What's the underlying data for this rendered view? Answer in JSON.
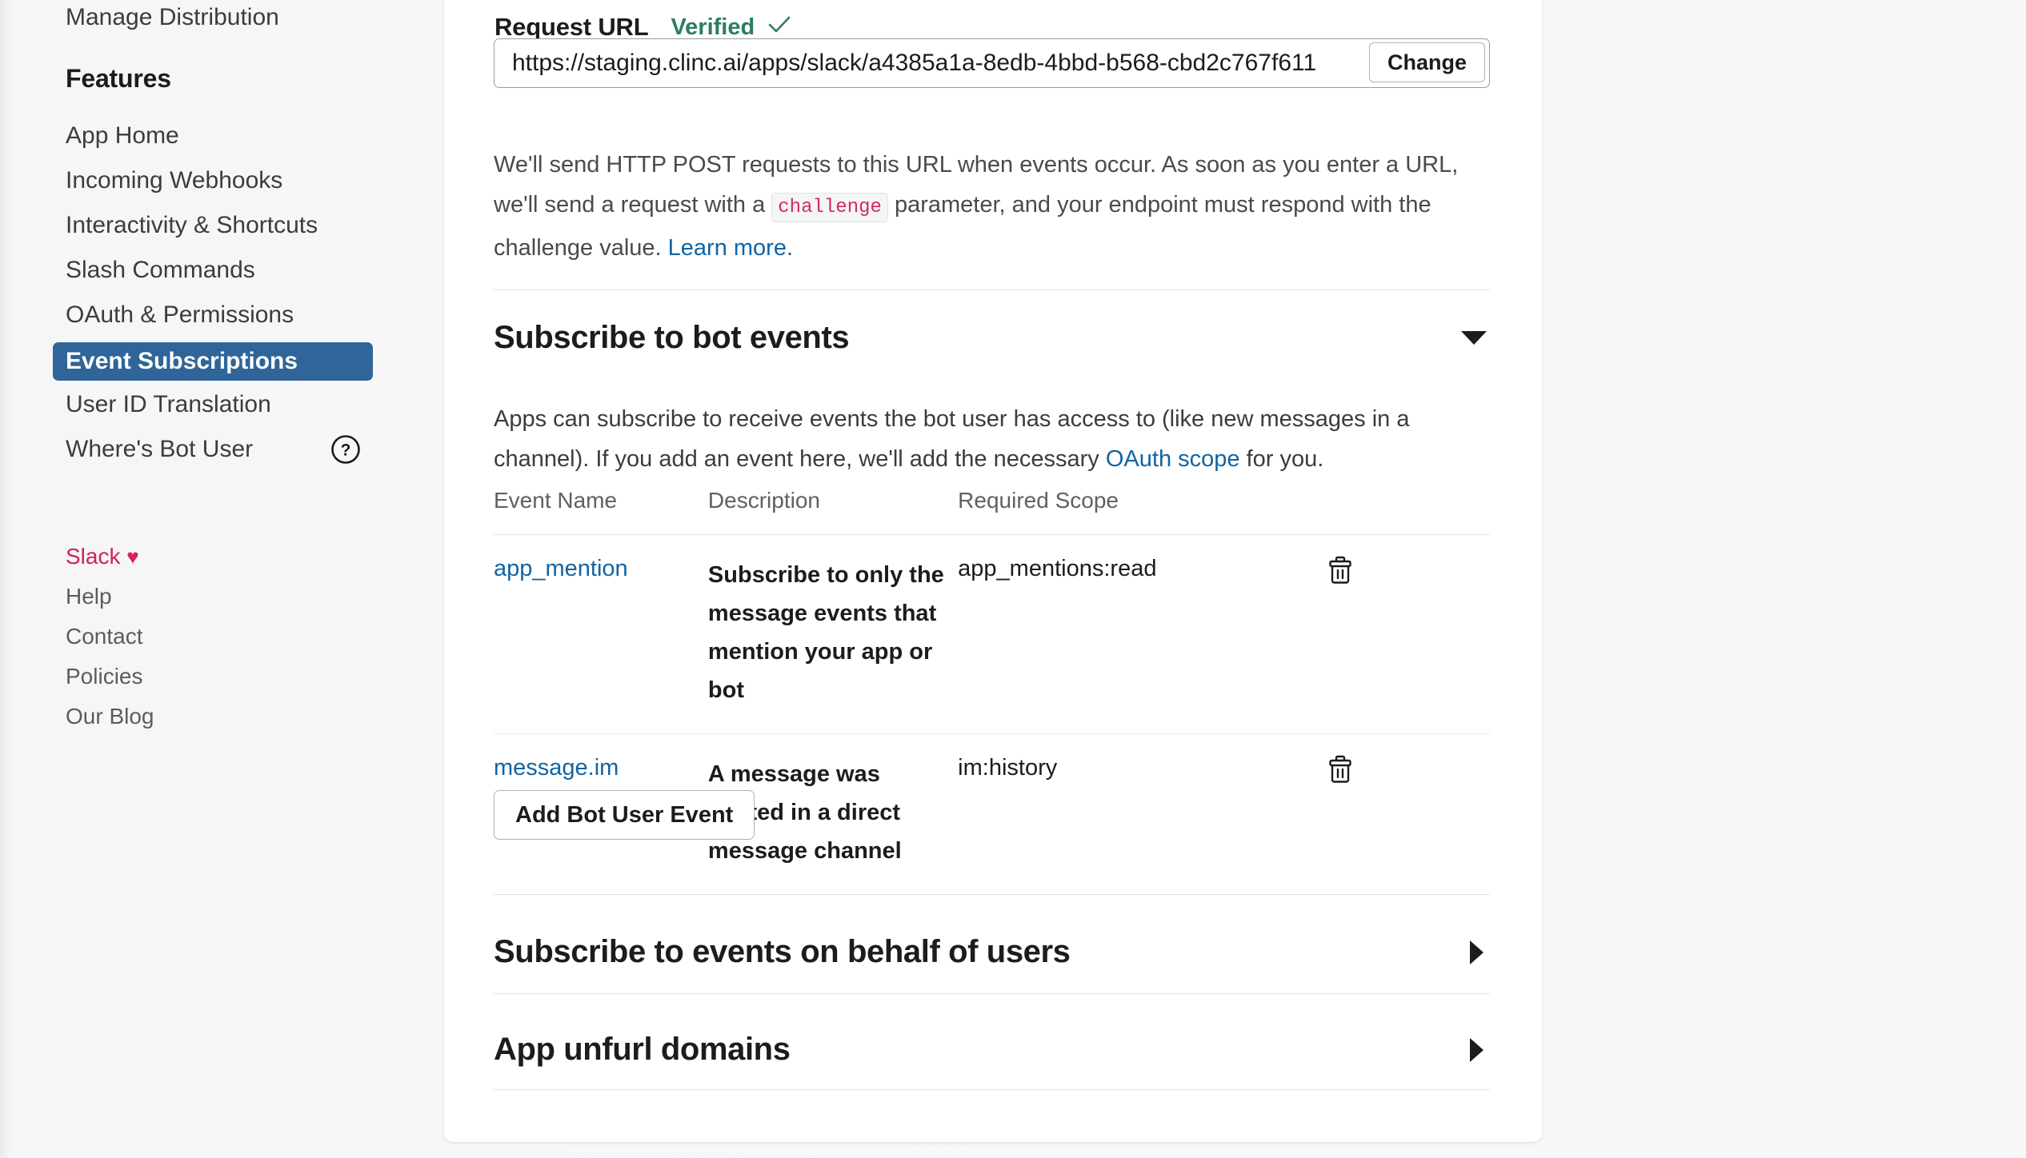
{
  "sidebar": {
    "manage_distribution": "Manage Distribution",
    "features_heading": "Features",
    "features": [
      {
        "label": "App Home"
      },
      {
        "label": "Incoming Webhooks"
      },
      {
        "label": "Interactivity & Shortcuts"
      },
      {
        "label": "Slash Commands"
      },
      {
        "label": "OAuth & Permissions"
      },
      {
        "label": "Event Subscriptions"
      },
      {
        "label": "User ID Translation"
      },
      {
        "label": "Where's Bot User"
      }
    ],
    "help_icon": "question-mark-circle-icon",
    "footer": {
      "slack": "Slack",
      "heart": "♥",
      "links": [
        {
          "label": "Help"
        },
        {
          "label": "Contact"
        },
        {
          "label": "Policies"
        },
        {
          "label": "Our Blog"
        }
      ]
    }
  },
  "request_url": {
    "label": "Request URL",
    "status": "Verified",
    "check_icon": "✓",
    "value": "https://staging.clinc.ai/apps/slack/a4385a1a-8edb-4bbd-b568-cbd2c767f611",
    "change_label": "Change",
    "help_part1": "We'll send HTTP POST requests to this URL when events occur. As soon as you enter a URL, we'll send a request with a ",
    "help_code": "challenge",
    "help_part2": " parameter, and your endpoint must respond with the challenge value. ",
    "help_link": "Learn more."
  },
  "bot_events": {
    "title": "Subscribe to bot events",
    "expanded": true,
    "caret_icon": "caret-down-icon",
    "desc_part1": "Apps can subscribe to receive events the bot user has access to (like new messages in a channel). If you add an event here, we'll add the necessary ",
    "desc_link": "OAuth scope",
    "desc_part2": " for you.",
    "columns": [
      "Event Name",
      "Description",
      "Required Scope"
    ],
    "rows": [
      {
        "name": "app_mention",
        "description": "Subscribe to only the message events that mention your app or bot",
        "scope": "app_mentions:read",
        "delete_icon": "trash-icon"
      },
      {
        "name": "message.im",
        "description": "A message was posted in a direct message channel",
        "scope": "im:history",
        "delete_icon": "trash-icon"
      }
    ],
    "add_button": "Add Bot User Event"
  },
  "collapsed_sections": [
    {
      "title": "Subscribe to events on behalf of users",
      "caret_icon": "caret-right-icon"
    },
    {
      "title": "App unfurl domains",
      "caret_icon": "caret-right-icon"
    }
  ],
  "colors": {
    "accent_blue": "#1264a3",
    "selected_nav": "#2f6598",
    "verified_green": "#2e7d5e",
    "code_pink": "#d42a62",
    "slack_pink": "#cc2553"
  }
}
